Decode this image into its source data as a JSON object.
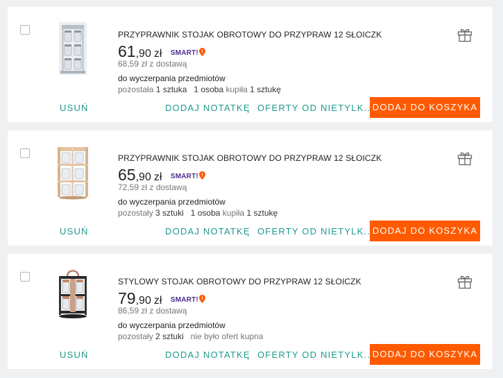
{
  "currency": "zł",
  "badge": "SMART!",
  "labels": {
    "remove": "USUŃ",
    "add_note": "DODAJ NOTATKĘ",
    "other_offers": "OFERTY OD NIETYLK...",
    "add_to_cart": "DODAJ DO KOSZYKA"
  },
  "colors": {
    "accent": "#ff5a00",
    "link": "#1e9a8c",
    "smart": "#4b2d8c"
  },
  "items": [
    {
      "title": "PRZYPRAWNIK STOJAK OBROTOWY DO PRZYPRAW 12 SŁOICZK",
      "price_int": "61",
      "price_dec": ",90",
      "delivery": "68,59 zł z dostawą",
      "availability": "do wyczerpania przedmiotów",
      "stock_prefix": "pozostała",
      "stock_value": "1 sztuka",
      "buyers_count": "1 osoba",
      "buyers_mid": "kupiła",
      "buyers_value": "1 sztukę",
      "image": "silver-spice-rack"
    },
    {
      "title": "PRZYPRAWNIK STOJAK OBROTOWY DO PRZYPRAW 12 SŁOICZK",
      "price_int": "65",
      "price_dec": ",90",
      "delivery": "72,59 zł z dostawą",
      "availability": "do wyczerpania przedmiotów",
      "stock_prefix": "pozostały",
      "stock_value": "3 sztuki",
      "buyers_count": "1 osoba",
      "buyers_mid": "kupiła",
      "buyers_value": "1 sztukę",
      "image": "bamboo-spice-rack"
    },
    {
      "title": "STYLOWY STOJAK OBROTOWY DO PRZYPRAW 12 SŁOICZK",
      "price_int": "79",
      "price_dec": ",90",
      "delivery": "86,59 zł z dostawą",
      "availability": "do wyczerpania przedmiotów",
      "stock_prefix": "pozostały",
      "stock_value": "2 sztuki",
      "buyers_count": "",
      "buyers_mid": "nie było ofert kupna",
      "buyers_value": "",
      "image": "black-copper-spice-rack"
    }
  ]
}
